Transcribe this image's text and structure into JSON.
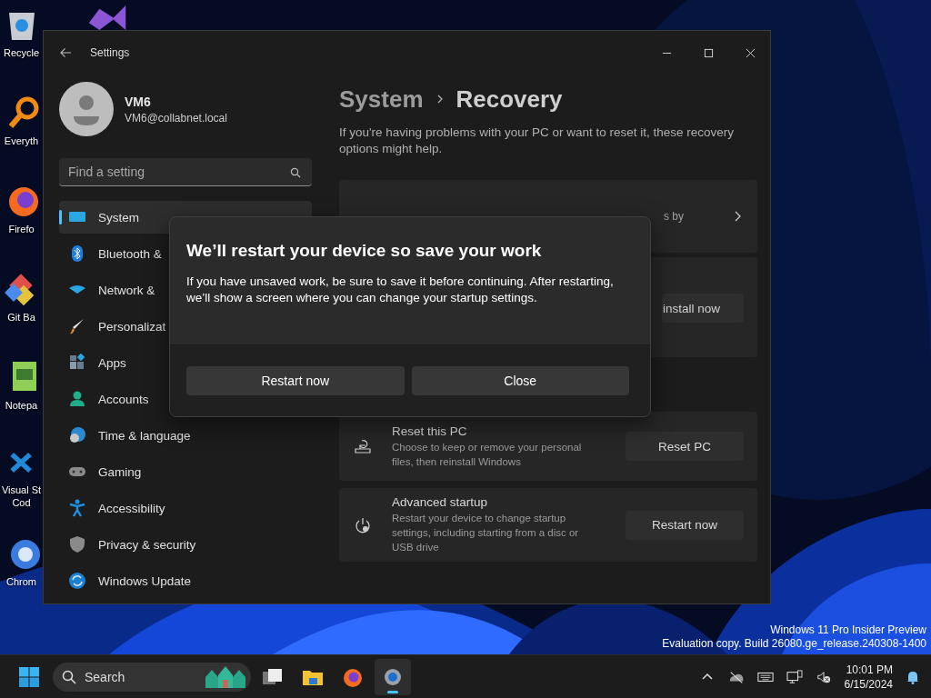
{
  "desktop": {
    "icons": [
      {
        "kind": "recycle",
        "lines": [
          "Recycle"
        ]
      },
      {
        "kind": "search-app",
        "lines": [
          "Everyth"
        ]
      },
      {
        "kind": "firefox",
        "lines": [
          "Firefo"
        ]
      },
      {
        "kind": "git",
        "lines": [
          "Git Ba"
        ]
      },
      {
        "kind": "notepad",
        "lines": [
          "Notepa"
        ]
      },
      {
        "kind": "vscode",
        "lines": [
          "Visual St",
          "Cod"
        ]
      },
      {
        "kind": "chrome",
        "lines": [
          "Chrom"
        ]
      }
    ],
    "watermark": [
      "Windows 11 Pro Insider Preview",
      "Evaluation copy. Build 26080.ge_release.240308-1400"
    ]
  },
  "window": {
    "title": "Settings",
    "account": {
      "name": "VM6",
      "email": "VM6@collabnet.local"
    },
    "search": {
      "placeholder": "Find a setting"
    },
    "nav": [
      {
        "kind": "system",
        "label": "System",
        "selected": true
      },
      {
        "kind": "bluetooth",
        "label": "Bluetooth &",
        "selected": false
      },
      {
        "kind": "network",
        "label": "Network &",
        "selected": false
      },
      {
        "kind": "personalization",
        "label": "Personalizat",
        "selected": false
      },
      {
        "kind": "apps",
        "label": "Apps",
        "selected": false
      },
      {
        "kind": "accounts",
        "label": "Accounts",
        "selected": false
      },
      {
        "kind": "time",
        "label": "Time & language",
        "selected": false
      },
      {
        "kind": "gaming",
        "label": "Gaming",
        "selected": false
      },
      {
        "kind": "accessibility",
        "label": "Accessibility",
        "selected": false
      },
      {
        "kind": "privacy",
        "label": "Privacy & security",
        "selected": false
      },
      {
        "kind": "update",
        "label": "Windows Update",
        "selected": false
      }
    ],
    "breadcrumb": [
      "System",
      "Recovery"
    ],
    "description": "If you're having problems with your PC or want to reset it, these recovery options might help.",
    "cards": [
      {
        "kind": "link",
        "text": "s by"
      },
      {
        "kind": "action",
        "button": "install now"
      }
    ],
    "options": [
      {
        "kind": "reset",
        "title": "Reset this PC",
        "description": "Choose to keep or remove your personal files, then reinstall Windows",
        "button": "Reset PC"
      },
      {
        "kind": "startup",
        "title": "Advanced startup",
        "description": "Restart your device to change startup settings, including starting from a disc or USB drive",
        "button": "Restart now"
      }
    ]
  },
  "dialog": {
    "title": "We’ll restart your device so save your work",
    "body": "If you have unsaved work, be sure to save it before continuing. After restarting, we’ll show a screen where you can change your startup settings.",
    "buttons": [
      "Restart now",
      "Close"
    ]
  },
  "taskbar": {
    "search": "Search",
    "apps": [
      {
        "kind": "taskview",
        "selected": false
      },
      {
        "kind": "files",
        "selected": false
      },
      {
        "kind": "firefox",
        "selected": false
      },
      {
        "kind": "settings",
        "selected": true
      }
    ],
    "time": "10:01 PM",
    "date": "6/15/2024"
  }
}
